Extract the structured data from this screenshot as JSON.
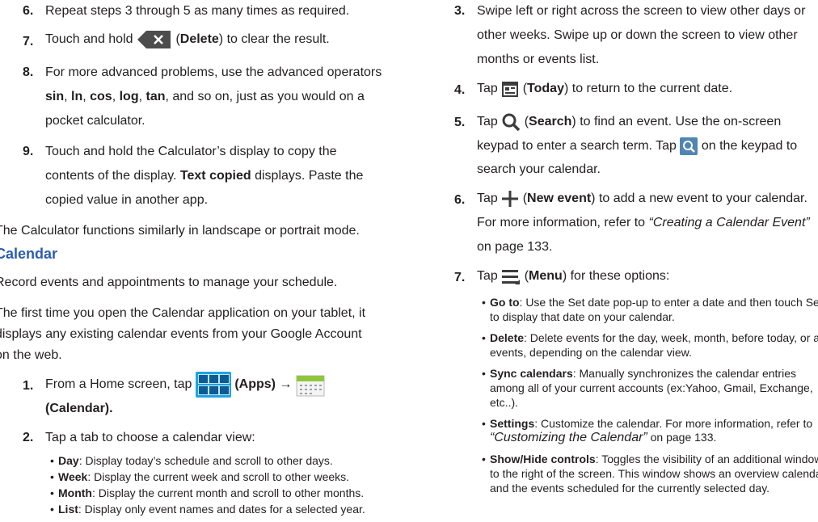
{
  "left": {
    "step6": {
      "num": "6.",
      "text": "Repeat steps 3 through 5 as many times as required."
    },
    "step7": {
      "num": "7.",
      "pre": "Touch and hold",
      "label": "Delete",
      "post": "to clear the result."
    },
    "step8": {
      "num": "8.",
      "line1": "For more advanced problems, use the advanced operators",
      "ops": [
        "sin",
        "ln",
        "cos",
        "log",
        "tan"
      ],
      "line2_tail": ", and so on, just as you would on a",
      "line3": "pocket calculator."
    },
    "step9": {
      "num": "9.",
      "line1": "Touch and hold the Calculator’s display to copy the",
      "line2_pre": "contents of the display. ",
      "line2_bold": "Text copied",
      "line2_post": " displays. Paste the",
      "line3": "copied value in another app."
    },
    "landscape_note": "The Calculator functions similarly in landscape or portrait mode.",
    "heading": "Calendar",
    "intro": "Record events and appointments to manage your schedule.",
    "para": [
      "The first time you open the Calendar application on your tablet, it",
      "displays any existing calendar events from your Google Account",
      "on the web."
    ],
    "step1": {
      "num": "1.",
      "pre": "From a Home screen, tap",
      "apps_label": "(Apps)",
      "arrow": "→",
      "cal_label": "(Calendar)."
    },
    "step2": {
      "num": "2.",
      "text": "Tap a tab to choose a calendar view:"
    },
    "views": [
      {
        "term": "Day",
        "desc": ": Display today’s schedule and scroll to other days."
      },
      {
        "term": "Week",
        "desc": ": Display the current week and scroll to other weeks."
      },
      {
        "term": "Month",
        "desc": ": Display the current month and scroll to other months."
      },
      {
        "term": "List",
        "desc": ": Display only event names and dates for a selected year."
      }
    ]
  },
  "right": {
    "step3": {
      "num": "3.",
      "lines": [
        "Swipe left or right across the screen to view other days or",
        "other weeks. Swipe up or down the screen to view other",
        "months or events list."
      ]
    },
    "step4": {
      "num": "4.",
      "pre": "Tap",
      "label": "Today",
      "post": "to return to the current date."
    },
    "step5": {
      "num": "5.",
      "pre": "Tap",
      "label": "Search",
      "post": "to find an event. Use the on-screen",
      "line2_pre": "keypad to enter a search term. Tap",
      "line2_post": "on the keypad to",
      "line3": "search your calendar."
    },
    "step6": {
      "num": "6.",
      "pre": "Tap",
      "label": "New event",
      "post": "to add a new event to your calendar.",
      "line2_pre": "For more information, refer to ",
      "line2_ref": "“Creating a Calendar Event”",
      "line3": "on page 133."
    },
    "step7": {
      "num": "7.",
      "pre": "Tap",
      "label": "Menu",
      "post": "for these options:"
    },
    "options": [
      {
        "term": "Go to",
        "lines": [
          ": Use the Set date pop-up to enter a date and then touch Set",
          "to display that date on your calendar."
        ]
      },
      {
        "term": "Delete",
        "lines": [
          ": Delete events for the day, week, month, before today, or all",
          "events, depending on the calendar view."
        ]
      },
      {
        "term": "Sync calendars",
        "lines": [
          ": Manually synchronizes the calendar entries",
          "among all of your current accounts (ex:Yahoo, Gmail, Exchange,",
          "etc..)."
        ]
      },
      {
        "term": "Settings",
        "lines": [
          ": Customize the calendar. For more information, refer to"
        ],
        "ref": "“Customizing the Calendar”",
        "ref_post": " on page 133."
      },
      {
        "term": "Show/Hide controls",
        "lines": [
          ": Toggles the visibility of an additional window",
          "to the right of the screen. This window shows an overview calendar",
          "and the events scheduled for the currently selected day."
        ]
      }
    ]
  },
  "colors": {
    "heading": "#2a5db0",
    "text": "#231f20",
    "apps_blue": "#1fa3e0"
  }
}
